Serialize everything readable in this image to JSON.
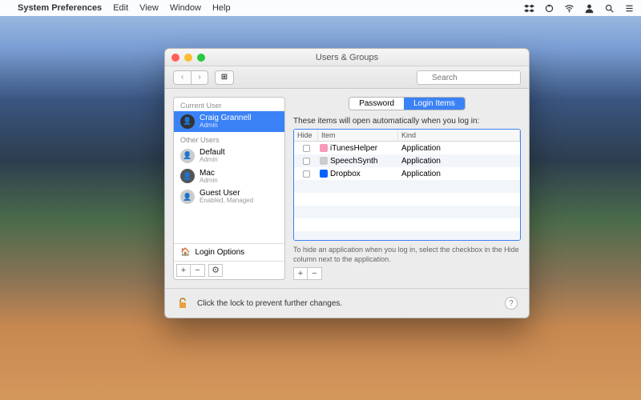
{
  "menubar": {
    "app_name": "System Preferences",
    "items": [
      "Edit",
      "View",
      "Window",
      "Help"
    ]
  },
  "window": {
    "title": "Users & Groups",
    "search_placeholder": "Search"
  },
  "sidebar": {
    "current_label": "Current User",
    "other_label": "Other Users",
    "current_user": {
      "name": "Craig Grannell",
      "role": "Admin"
    },
    "other_users": [
      {
        "name": "Default",
        "role": "Admin"
      },
      {
        "name": "Mac",
        "role": "Admin"
      },
      {
        "name": "Guest User",
        "role": "Enabled, Managed"
      }
    ],
    "login_options": "Login Options"
  },
  "tabs": {
    "password": "Password",
    "login_items": "Login Items"
  },
  "main": {
    "hint": "These items will open automatically when you log in:",
    "columns": {
      "hide": "Hide",
      "item": "Item",
      "kind": "Kind"
    },
    "rows": [
      {
        "item": "iTunesHelper",
        "kind": "Application",
        "icon_color": "#f79bb8"
      },
      {
        "item": "SpeechSynth",
        "kind": "Application",
        "icon_color": "#cccccc"
      },
      {
        "item": "Dropbox",
        "kind": "Application",
        "icon_color": "#0061ff"
      }
    ],
    "hide_hint": "To hide an application when you log in, select the checkbox in the Hide column next to the application."
  },
  "lock": {
    "text": "Click the lock to prevent further changes."
  }
}
